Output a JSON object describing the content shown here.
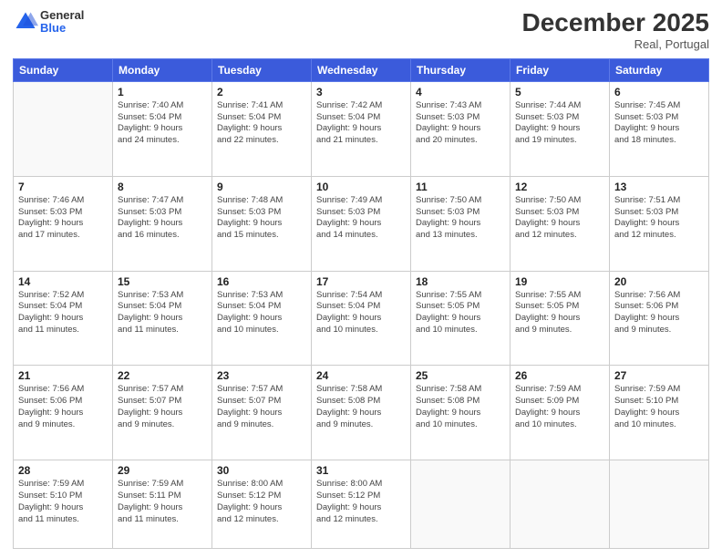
{
  "header": {
    "logo_general": "General",
    "logo_blue": "Blue",
    "month_title": "December 2025",
    "location": "Real, Portugal"
  },
  "weekdays": [
    "Sunday",
    "Monday",
    "Tuesday",
    "Wednesday",
    "Thursday",
    "Friday",
    "Saturday"
  ],
  "weeks": [
    [
      {
        "day": "",
        "info": ""
      },
      {
        "day": "1",
        "info": "Sunrise: 7:40 AM\nSunset: 5:04 PM\nDaylight: 9 hours\nand 24 minutes."
      },
      {
        "day": "2",
        "info": "Sunrise: 7:41 AM\nSunset: 5:04 PM\nDaylight: 9 hours\nand 22 minutes."
      },
      {
        "day": "3",
        "info": "Sunrise: 7:42 AM\nSunset: 5:04 PM\nDaylight: 9 hours\nand 21 minutes."
      },
      {
        "day": "4",
        "info": "Sunrise: 7:43 AM\nSunset: 5:03 PM\nDaylight: 9 hours\nand 20 minutes."
      },
      {
        "day": "5",
        "info": "Sunrise: 7:44 AM\nSunset: 5:03 PM\nDaylight: 9 hours\nand 19 minutes."
      },
      {
        "day": "6",
        "info": "Sunrise: 7:45 AM\nSunset: 5:03 PM\nDaylight: 9 hours\nand 18 minutes."
      }
    ],
    [
      {
        "day": "7",
        "info": "Sunrise: 7:46 AM\nSunset: 5:03 PM\nDaylight: 9 hours\nand 17 minutes."
      },
      {
        "day": "8",
        "info": "Sunrise: 7:47 AM\nSunset: 5:03 PM\nDaylight: 9 hours\nand 16 minutes."
      },
      {
        "day": "9",
        "info": "Sunrise: 7:48 AM\nSunset: 5:03 PM\nDaylight: 9 hours\nand 15 minutes."
      },
      {
        "day": "10",
        "info": "Sunrise: 7:49 AM\nSunset: 5:03 PM\nDaylight: 9 hours\nand 14 minutes."
      },
      {
        "day": "11",
        "info": "Sunrise: 7:50 AM\nSunset: 5:03 PM\nDaylight: 9 hours\nand 13 minutes."
      },
      {
        "day": "12",
        "info": "Sunrise: 7:50 AM\nSunset: 5:03 PM\nDaylight: 9 hours\nand 12 minutes."
      },
      {
        "day": "13",
        "info": "Sunrise: 7:51 AM\nSunset: 5:03 PM\nDaylight: 9 hours\nand 12 minutes."
      }
    ],
    [
      {
        "day": "14",
        "info": "Sunrise: 7:52 AM\nSunset: 5:04 PM\nDaylight: 9 hours\nand 11 minutes."
      },
      {
        "day": "15",
        "info": "Sunrise: 7:53 AM\nSunset: 5:04 PM\nDaylight: 9 hours\nand 11 minutes."
      },
      {
        "day": "16",
        "info": "Sunrise: 7:53 AM\nSunset: 5:04 PM\nDaylight: 9 hours\nand 10 minutes."
      },
      {
        "day": "17",
        "info": "Sunrise: 7:54 AM\nSunset: 5:04 PM\nDaylight: 9 hours\nand 10 minutes."
      },
      {
        "day": "18",
        "info": "Sunrise: 7:55 AM\nSunset: 5:05 PM\nDaylight: 9 hours\nand 10 minutes."
      },
      {
        "day": "19",
        "info": "Sunrise: 7:55 AM\nSunset: 5:05 PM\nDaylight: 9 hours\nand 9 minutes."
      },
      {
        "day": "20",
        "info": "Sunrise: 7:56 AM\nSunset: 5:06 PM\nDaylight: 9 hours\nand 9 minutes."
      }
    ],
    [
      {
        "day": "21",
        "info": "Sunrise: 7:56 AM\nSunset: 5:06 PM\nDaylight: 9 hours\nand 9 minutes."
      },
      {
        "day": "22",
        "info": "Sunrise: 7:57 AM\nSunset: 5:07 PM\nDaylight: 9 hours\nand 9 minutes."
      },
      {
        "day": "23",
        "info": "Sunrise: 7:57 AM\nSunset: 5:07 PM\nDaylight: 9 hours\nand 9 minutes."
      },
      {
        "day": "24",
        "info": "Sunrise: 7:58 AM\nSunset: 5:08 PM\nDaylight: 9 hours\nand 9 minutes."
      },
      {
        "day": "25",
        "info": "Sunrise: 7:58 AM\nSunset: 5:08 PM\nDaylight: 9 hours\nand 10 minutes."
      },
      {
        "day": "26",
        "info": "Sunrise: 7:59 AM\nSunset: 5:09 PM\nDaylight: 9 hours\nand 10 minutes."
      },
      {
        "day": "27",
        "info": "Sunrise: 7:59 AM\nSunset: 5:10 PM\nDaylight: 9 hours\nand 10 minutes."
      }
    ],
    [
      {
        "day": "28",
        "info": "Sunrise: 7:59 AM\nSunset: 5:10 PM\nDaylight: 9 hours\nand 11 minutes."
      },
      {
        "day": "29",
        "info": "Sunrise: 7:59 AM\nSunset: 5:11 PM\nDaylight: 9 hours\nand 11 minutes."
      },
      {
        "day": "30",
        "info": "Sunrise: 8:00 AM\nSunset: 5:12 PM\nDaylight: 9 hours\nand 12 minutes."
      },
      {
        "day": "31",
        "info": "Sunrise: 8:00 AM\nSunset: 5:12 PM\nDaylight: 9 hours\nand 12 minutes."
      },
      {
        "day": "",
        "info": ""
      },
      {
        "day": "",
        "info": ""
      },
      {
        "day": "",
        "info": ""
      }
    ]
  ]
}
